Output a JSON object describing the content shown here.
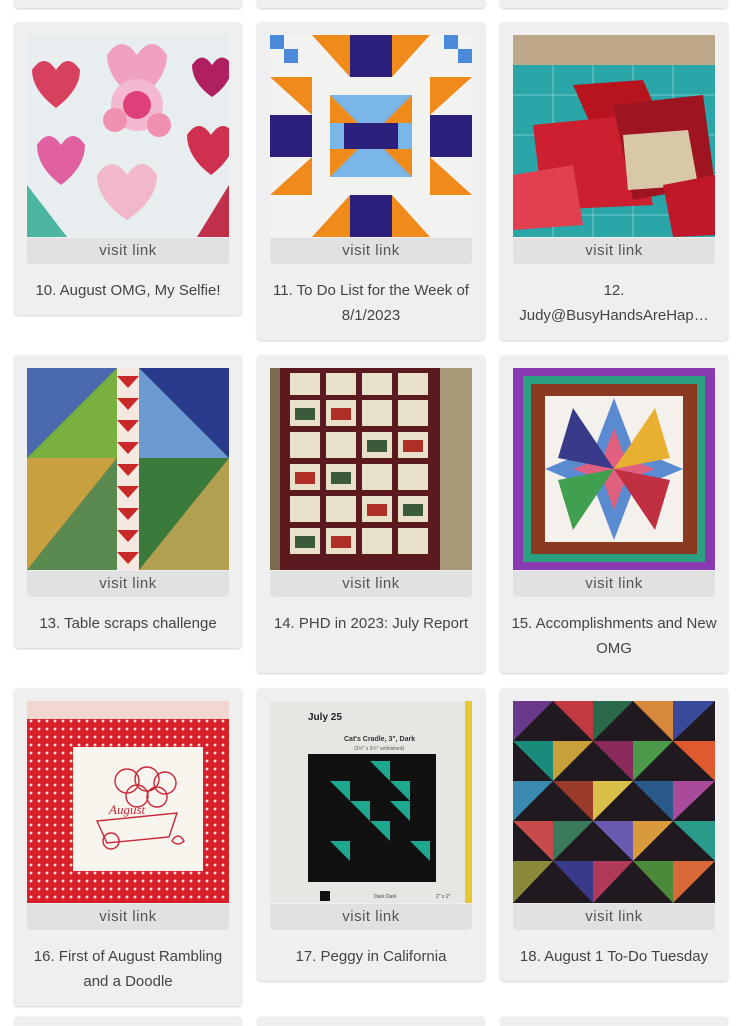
{
  "link_label": "visit link",
  "entries": [
    {
      "title": "10. August OMG, My Selfie!",
      "thumb": "pink-hearts-applique-quilt"
    },
    {
      "title": "11. To Do List for the Week of 8/1/2023",
      "thumb": "orange-blue-star-quilt"
    },
    {
      "title": "12. Judy@BusyHandsAreHap…",
      "thumb": "red-fabric-scraps-on-cutting-mat"
    },
    {
      "title": "13. Table scraps challenge",
      "thumb": "scrappy-string-quilt"
    },
    {
      "title": "14. PHD in 2023: July Report",
      "thumb": "folk-art-block-quilt"
    },
    {
      "title": "15. Accomplishments and New OMG",
      "thumb": "scrappy-star-quilt-purple-border"
    },
    {
      "title": "16. First of August Rambling and a Doodle",
      "thumb": "august-redwork-embroidery"
    },
    {
      "title": "17. Peggy in California",
      "thumb": "cats-cradle-block-july-25"
    },
    {
      "title": "18. August 1 To-Do Tuesday",
      "thumb": "multicolor-triangle-quilt"
    }
  ],
  "thumb_text": {
    "block_date": "July 25",
    "block_name": "Cat's Cradle, 3\", Dark",
    "block_size": "(3½\" x 3½\" unfinished)",
    "block_scheme": "Dark Dark",
    "block_unit": "2\" x 2\"",
    "embroidery_word": "August"
  }
}
